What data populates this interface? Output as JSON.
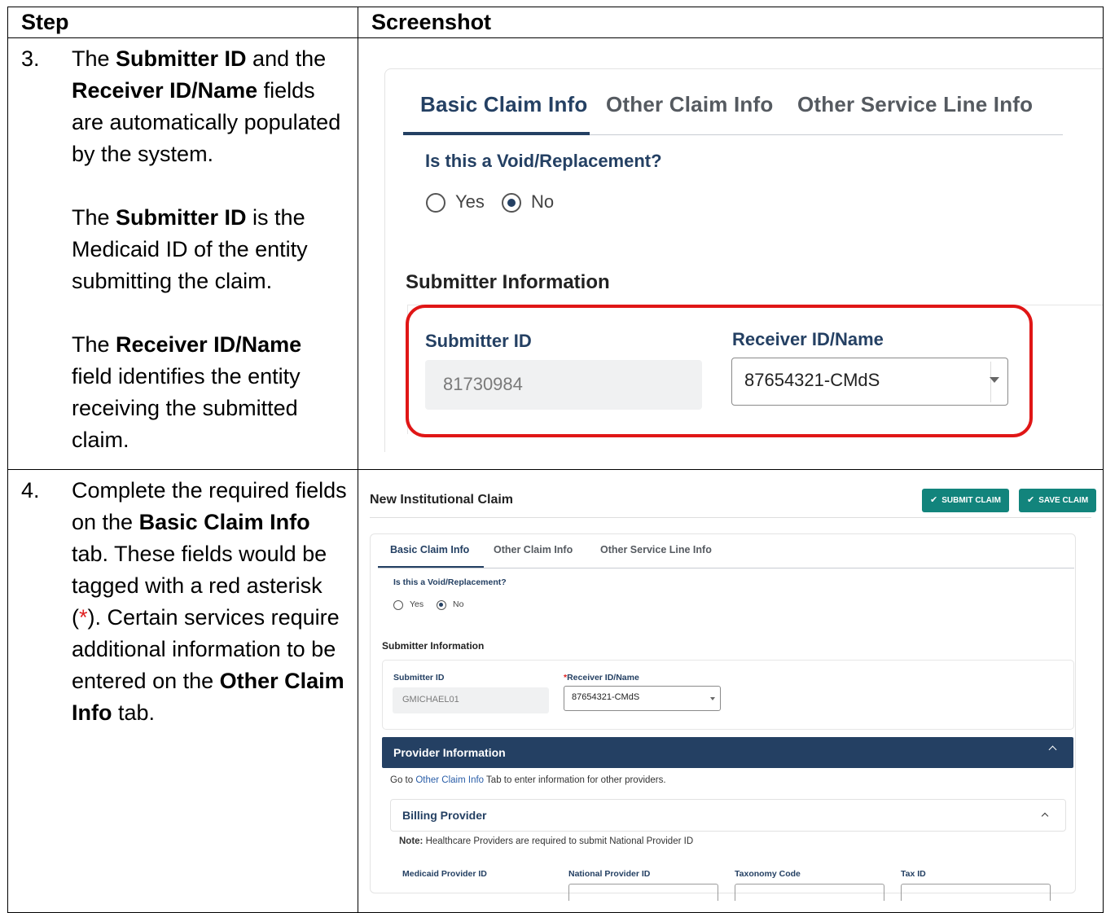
{
  "table": {
    "header_step": "Step",
    "header_screenshot": "Screenshot"
  },
  "step3": {
    "number": "3.",
    "p1": {
      "a": "The ",
      "b1": "Submitter ID",
      "c": " and the ",
      "b2": "Receiver ID/Name",
      "d": " fields are automatically populated by the system."
    },
    "p2": {
      "a": "The ",
      "b1": "Submitter ID",
      "c": " is the Medicaid ID of the entity submitting the claim."
    },
    "p3": {
      "a": "The ",
      "b1": "Receiver ID/Name",
      "c": " field identifies the entity receiving the submitted claim."
    }
  },
  "step4": {
    "number": "4.",
    "a": "Complete the required fields on the ",
    "b1": "Basic Claim Info",
    "c": " tab. These fields would be tagged with a red asterisk (",
    "star": "*",
    "d": "). Certain services require additional information to be entered on the ",
    "b2": "Other Claim Info",
    "e": " tab."
  },
  "shot1": {
    "tabs": [
      "Basic Claim Info",
      "Other Claim Info",
      "Other Service Line Info"
    ],
    "question": "Is this a Void/Replacement?",
    "radio_yes": "Yes",
    "radio_no": "No",
    "section": "Submitter Information",
    "submitter_label": "Submitter ID",
    "submitter_value": "81730984",
    "receiver_label": "Receiver ID/Name",
    "receiver_value": "87654321-CMdS",
    "highlight_color": "#e01616"
  },
  "shot2": {
    "page_title": "New Institutional Claim",
    "submit_button": "SUBMIT CLAIM",
    "save_button": "SAVE CLAIM",
    "tabs": [
      "Basic Claim Info",
      "Other Claim Info",
      "Other Service Line Info"
    ],
    "question": "Is this a Void/Replacement?",
    "radio_yes": "Yes",
    "radio_no": "No",
    "section": "Submitter Information",
    "submitter_label": "Submitter ID",
    "submitter_value": "GMICHAEL01",
    "receiver_star": "*",
    "receiver_label": "Receiver ID/Name",
    "receiver_value": "87654321-CMdS",
    "provider_bar": "Provider Information",
    "goto_a": "Go to ",
    "goto_link": "Other Claim Info",
    "goto_b": " Tab to enter information for other providers.",
    "billing_provider": "Billing Provider",
    "note_label": "Note:",
    "note_text": " Healthcare Providers are required to submit National Provider ID",
    "columns": [
      "Medicaid Provider ID",
      "National Provider ID",
      "Taxonomy Code",
      "Tax ID"
    ],
    "accent_color": "#244063",
    "button_color": "#12847c"
  }
}
